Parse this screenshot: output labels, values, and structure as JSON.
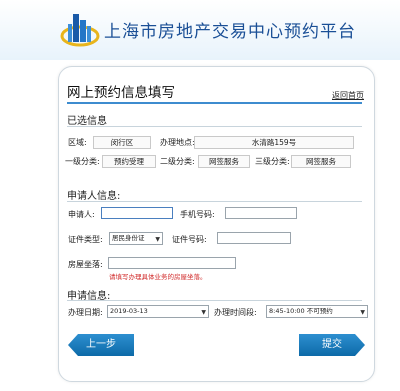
{
  "header": {
    "site_title": "上海市房地产交易中心预约平台",
    "logo_icon": "building-logo-icon"
  },
  "form": {
    "title": "网上预约信息填写",
    "back_link": "返回首页",
    "selected": {
      "heading": "已选信息",
      "district_label": "区域:",
      "district_value": "闵行区",
      "location_label": "办理地点:",
      "location_value": "水清路159号",
      "cat1_label": "一级分类:",
      "cat1_value": "预约受理",
      "cat2_label": "二级分类:",
      "cat2_value": "网签服务",
      "cat3_label": "三级分类:",
      "cat3_value": "网签服务"
    },
    "applicant": {
      "heading": "申请人信息:",
      "name_label": "申请人:",
      "name_value": "",
      "phone_label": "手机号码:",
      "phone_value": "",
      "id_type_label": "证件类型:",
      "id_type_value": "居民身份证",
      "id_no_label": "证件号码:",
      "id_no_value": "",
      "house_label": "房屋坐落:",
      "house_value": "",
      "house_hint": "请填写办理具体业务的房屋坐落。"
    },
    "apply": {
      "heading": "申请信息:",
      "date_label": "办理日期:",
      "date_value": "2019-03-13",
      "time_label": "办理时间段:",
      "time_value": "8:45-10:00 不可预约"
    },
    "buttons": {
      "prev": "上一步",
      "submit": "提交"
    },
    "colors": {
      "accent": "#1d7fc0",
      "title_blue": "#1a4f96",
      "hint_red": "#d12a2a"
    }
  }
}
